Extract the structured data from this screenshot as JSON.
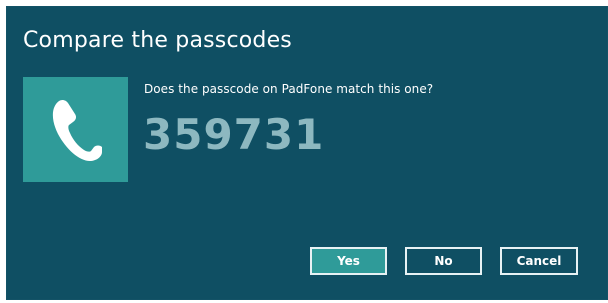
{
  "dialog": {
    "title": "Compare the passcodes",
    "question": "Does the passcode on PadFone match this one?",
    "passcode": "359731",
    "device_icon": "phone-icon",
    "colors": {
      "background": "#0f4f63",
      "tile": "#2f9b99",
      "passcode": "#8db8c0",
      "button_border": "#e7f2f4"
    }
  },
  "buttons": {
    "yes": "Yes",
    "no": "No",
    "cancel": "Cancel"
  }
}
